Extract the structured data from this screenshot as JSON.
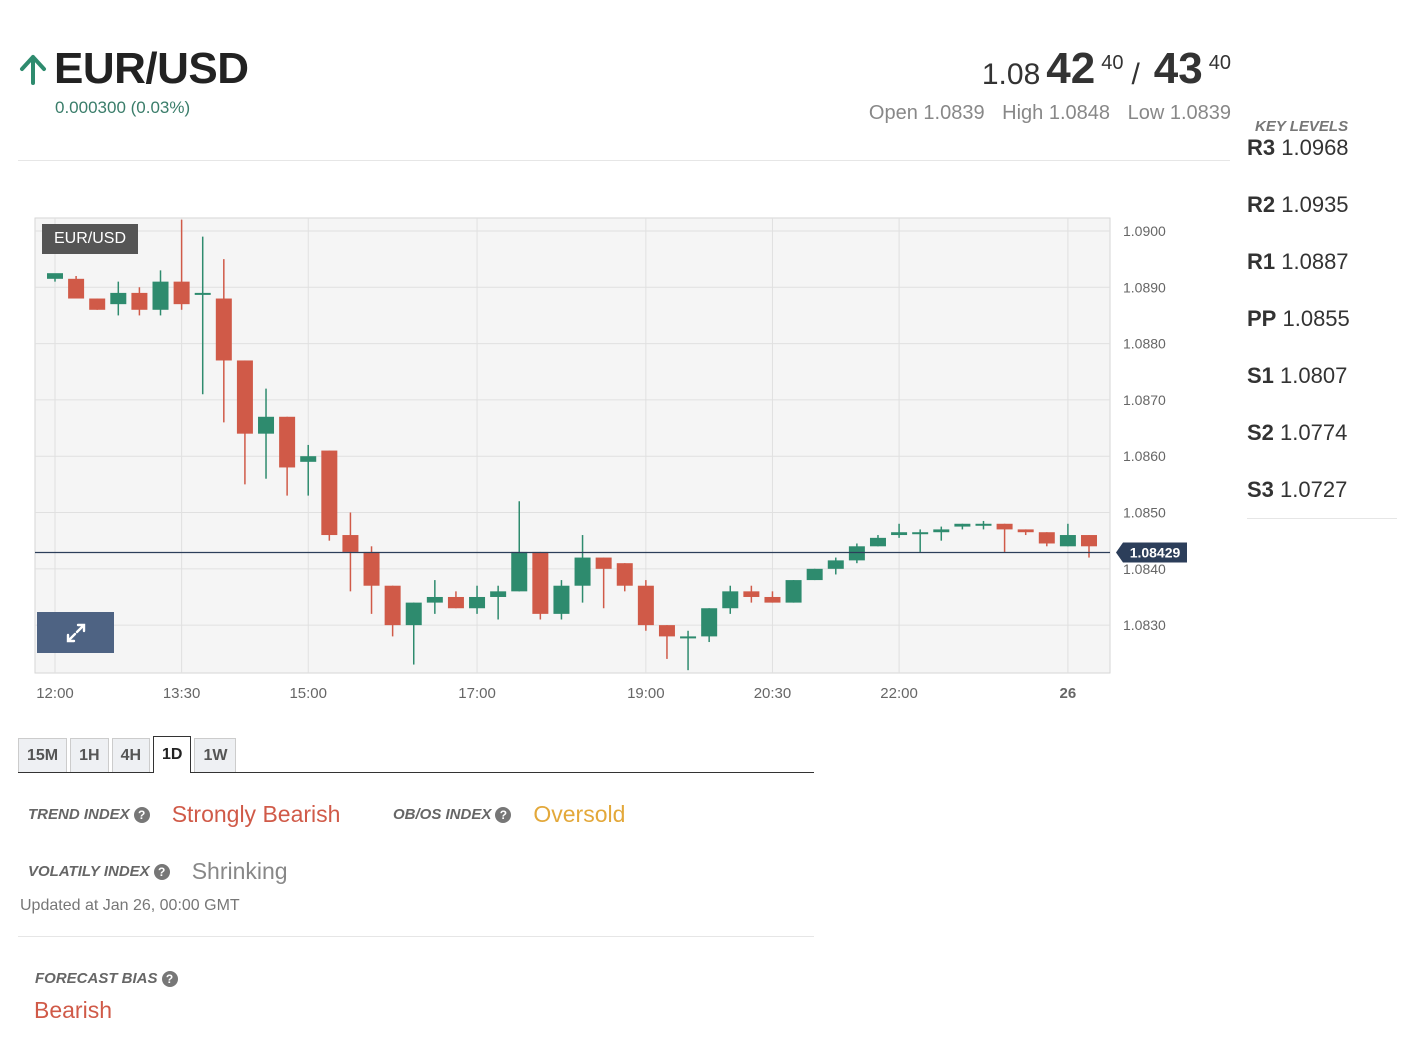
{
  "pair": {
    "name": "EUR/USD",
    "direction_icon": "arrow-up-icon",
    "change": "0.000300 (0.03%)"
  },
  "quote": {
    "bid_base": "1.08",
    "bid_big": "42",
    "bid_pip": "40",
    "separator": "/",
    "ask_big": "43",
    "ask_pip": "40",
    "open": "Open 1.0839",
    "high": "High 1.0848",
    "low": "Low 1.0839"
  },
  "key_levels": {
    "title": "KEY LEVELS",
    "levels": [
      {
        "name": "R3",
        "value": "1.0968"
      },
      {
        "name": "R2",
        "value": "1.0935"
      },
      {
        "name": "R1",
        "value": "1.0887"
      },
      {
        "name": "PP",
        "value": "1.0855"
      },
      {
        "name": "S1",
        "value": "1.0807"
      },
      {
        "name": "S2",
        "value": "1.0774"
      },
      {
        "name": "S3",
        "value": "1.0727"
      }
    ]
  },
  "chart_badge": "EUR/USD",
  "chart_data": {
    "type": "candlestick",
    "ylim": [
      1.08215,
      1.09023
    ],
    "y_ticks": [
      "1.0900",
      "1.0890",
      "1.0880",
      "1.0870",
      "1.0860",
      "1.0850",
      "1.0840",
      "1.0830"
    ],
    "y_tick_values": [
      1.09,
      1.089,
      1.088,
      1.087,
      1.086,
      1.085,
      1.084,
      1.083
    ],
    "x_ticks": [
      "12:00",
      "13:30",
      "15:00",
      "17:00",
      "19:00",
      "20:30",
      "22:00",
      "26"
    ],
    "x_tick_minutes": [
      0,
      90,
      180,
      300,
      420,
      510,
      600,
      720
    ],
    "x_max_minutes": 735,
    "current_price": "1.08429",
    "current_value": 1.08429,
    "colors": {
      "up": "#2e8b6e",
      "down": "#d05a48",
      "price_line": "#2c3e5a"
    },
    "candles": [
      {
        "t": 0,
        "o": 1.08915,
        "h": 1.0892,
        "l": 1.0891,
        "c": 1.08925
      },
      {
        "t": 15,
        "o": 1.08915,
        "h": 1.0892,
        "l": 1.0889,
        "c": 1.0888
      },
      {
        "t": 30,
        "o": 1.0888,
        "h": 1.0888,
        "l": 1.0886,
        "c": 1.0886
      },
      {
        "t": 45,
        "o": 1.0887,
        "h": 1.0891,
        "l": 1.0885,
        "c": 1.0889
      },
      {
        "t": 60,
        "o": 1.0889,
        "h": 1.089,
        "l": 1.0885,
        "c": 1.0886
      },
      {
        "t": 75,
        "o": 1.0886,
        "h": 1.0893,
        "l": 1.0885,
        "c": 1.0891
      },
      {
        "t": 90,
        "o": 1.0891,
        "h": 1.0902,
        "l": 1.0886,
        "c": 1.0887
      },
      {
        "t": 105,
        "o": 1.0889,
        "h": 1.0899,
        "l": 1.0871,
        "c": 1.0889
      },
      {
        "t": 120,
        "o": 1.0888,
        "h": 1.0895,
        "l": 1.0866,
        "c": 1.0877
      },
      {
        "t": 135,
        "o": 1.0877,
        "h": 1.0877,
        "l": 1.0855,
        "c": 1.0864
      },
      {
        "t": 150,
        "o": 1.0864,
        "h": 1.0872,
        "l": 1.0856,
        "c": 1.0867
      },
      {
        "t": 165,
        "o": 1.0867,
        "h": 1.0867,
        "l": 1.0853,
        "c": 1.0858
      },
      {
        "t": 180,
        "o": 1.0859,
        "h": 1.0862,
        "l": 1.0853,
        "c": 1.086
      },
      {
        "t": 195,
        "o": 1.0861,
        "h": 1.0861,
        "l": 1.0845,
        "c": 1.0846
      },
      {
        "t": 210,
        "o": 1.0846,
        "h": 1.085,
        "l": 1.0836,
        "c": 1.0843
      },
      {
        "t": 225,
        "o": 1.0843,
        "h": 1.0844,
        "l": 1.0832,
        "c": 1.0837
      },
      {
        "t": 240,
        "o": 1.0837,
        "h": 1.0837,
        "l": 1.0828,
        "c": 1.083
      },
      {
        "t": 255,
        "o": 1.083,
        "h": 1.0834,
        "l": 1.0823,
        "c": 1.0834
      },
      {
        "t": 270,
        "o": 1.0834,
        "h": 1.0838,
        "l": 1.0832,
        "c": 1.0835
      },
      {
        "t": 285,
        "o": 1.0835,
        "h": 1.0836,
        "l": 1.0833,
        "c": 1.0833
      },
      {
        "t": 300,
        "o": 1.0833,
        "h": 1.0837,
        "l": 1.0832,
        "c": 1.0835
      },
      {
        "t": 315,
        "o": 1.0835,
        "h": 1.0837,
        "l": 1.0831,
        "c": 1.0836
      },
      {
        "t": 330,
        "o": 1.0836,
        "h": 1.0852,
        "l": 1.0836,
        "c": 1.0843
      },
      {
        "t": 345,
        "o": 1.0843,
        "h": 1.0843,
        "l": 1.0831,
        "c": 1.0832
      },
      {
        "t": 360,
        "o": 1.0832,
        "h": 1.0838,
        "l": 1.0831,
        "c": 1.0837
      },
      {
        "t": 375,
        "o": 1.0837,
        "h": 1.0846,
        "l": 1.0834,
        "c": 1.0842
      },
      {
        "t": 390,
        "o": 1.0842,
        "h": 1.0842,
        "l": 1.0833,
        "c": 1.084
      },
      {
        "t": 405,
        "o": 1.0841,
        "h": 1.0841,
        "l": 1.0836,
        "c": 1.0837
      },
      {
        "t": 420,
        "o": 1.0837,
        "h": 1.0838,
        "l": 1.0829,
        "c": 1.083
      },
      {
        "t": 435,
        "o": 1.083,
        "h": 1.083,
        "l": 1.0824,
        "c": 1.0828
      },
      {
        "t": 450,
        "o": 1.0828,
        "h": 1.0829,
        "l": 1.0822,
        "c": 1.0828
      },
      {
        "t": 465,
        "o": 1.0828,
        "h": 1.0833,
        "l": 1.0827,
        "c": 1.0833
      },
      {
        "t": 480,
        "o": 1.0833,
        "h": 1.0837,
        "l": 1.0832,
        "c": 1.0836
      },
      {
        "t": 495,
        "o": 1.0836,
        "h": 1.0837,
        "l": 1.0834,
        "c": 1.0835
      },
      {
        "t": 510,
        "o": 1.0835,
        "h": 1.0836,
        "l": 1.0834,
        "c": 1.0834
      },
      {
        "t": 525,
        "o": 1.0834,
        "h": 1.0838,
        "l": 1.0834,
        "c": 1.0838
      },
      {
        "t": 540,
        "o": 1.0838,
        "h": 1.084,
        "l": 1.0838,
        "c": 1.084
      },
      {
        "t": 555,
        "o": 1.084,
        "h": 1.0842,
        "l": 1.0839,
        "c": 1.08415
      },
      {
        "t": 570,
        "o": 1.08415,
        "h": 1.08445,
        "l": 1.0841,
        "c": 1.0844
      },
      {
        "t": 585,
        "o": 1.0844,
        "h": 1.0846,
        "l": 1.0844,
        "c": 1.08455
      },
      {
        "t": 600,
        "o": 1.0846,
        "h": 1.0848,
        "l": 1.08455,
        "c": 1.08465
      },
      {
        "t": 615,
        "o": 1.08465,
        "h": 1.0847,
        "l": 1.0843,
        "c": 1.08465
      },
      {
        "t": 630,
        "o": 1.08465,
        "h": 1.08475,
        "l": 1.0845,
        "c": 1.0847
      },
      {
        "t": 645,
        "o": 1.08475,
        "h": 1.0848,
        "l": 1.0847,
        "c": 1.0848
      },
      {
        "t": 660,
        "o": 1.0848,
        "h": 1.08485,
        "l": 1.0847,
        "c": 1.0848
      },
      {
        "t": 675,
        "o": 1.0848,
        "h": 1.0848,
        "l": 1.0843,
        "c": 1.0847
      },
      {
        "t": 690,
        "o": 1.0847,
        "h": 1.0847,
        "l": 1.0846,
        "c": 1.08465
      },
      {
        "t": 705,
        "o": 1.08465,
        "h": 1.08465,
        "l": 1.0844,
        "c": 1.08445
      },
      {
        "t": 720,
        "o": 1.0844,
        "h": 1.0848,
        "l": 1.0844,
        "c": 1.0846
      },
      {
        "t": 735,
        "o": 1.0846,
        "h": 1.0846,
        "l": 1.0842,
        "c": 1.0844
      }
    ]
  },
  "tabs": [
    {
      "label": "15M",
      "active": false
    },
    {
      "label": "1H",
      "active": false
    },
    {
      "label": "4H",
      "active": false
    },
    {
      "label": "1D",
      "active": true
    },
    {
      "label": "1W",
      "active": false
    }
  ],
  "indexes": {
    "trend_label": "TREND INDEX",
    "trend_value": "Strongly Bearish",
    "obos_label": "OB/OS INDEX",
    "obos_value": "Oversold",
    "volatility_label": "VOLATILY INDEX",
    "volatility_value": "Shrinking",
    "help_icon": "question-icon"
  },
  "updated": "Updated at Jan 26, 00:00 GMT",
  "forecast": {
    "label": "FORECAST BIAS",
    "value": "Bearish"
  }
}
